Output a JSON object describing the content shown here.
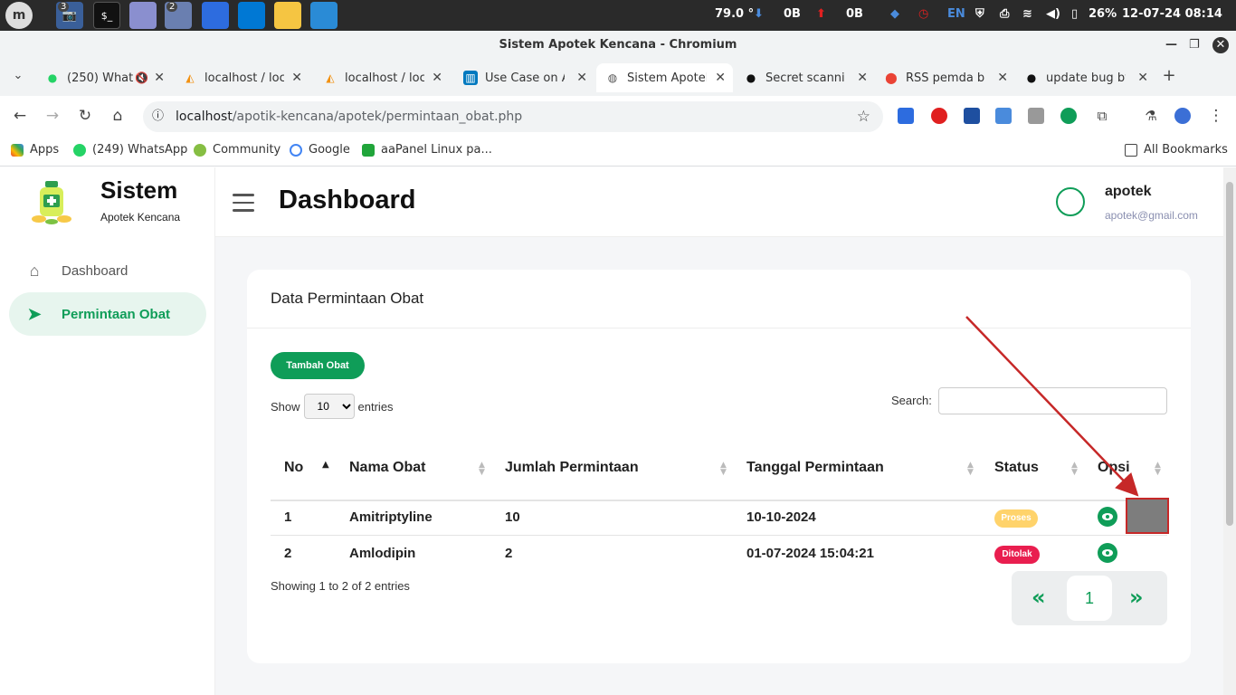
{
  "taskbar": {
    "badges": {
      "camera": "3",
      "browser": "2"
    },
    "temp": "79.0 °",
    "net_down": "0B",
    "net_up": "0B",
    "lang": "EN",
    "battery": "26%",
    "datetime": "12-07-24 08:14"
  },
  "window": {
    "title": "Sistem Apotek Kencana - Chromium"
  },
  "tabs": [
    {
      "title": "(250) What",
      "icon": "whatsapp-icon"
    },
    {
      "title": "localhost / loc",
      "icon": "phpmyadmin-icon"
    },
    {
      "title": "localhost / loc",
      "icon": "phpmyadmin-icon"
    },
    {
      "title": "Use Case on A",
      "icon": "trello-icon"
    },
    {
      "title": "Sistem Apotek",
      "icon": "globe-icon"
    },
    {
      "title": "Secret scannin",
      "icon": "github-icon"
    },
    {
      "title": "RSS pemda bli",
      "icon": "maps-icon"
    },
    {
      "title": "update bug by",
      "icon": "github-icon"
    }
  ],
  "address": {
    "host": "localhost",
    "path": "/apotik-kencana/apotek/permintaan_obat.php"
  },
  "bookmarks": {
    "apps": "Apps",
    "whatsapp": "(249) WhatsApp",
    "community": "Community",
    "google": "Google",
    "aapanel": "aaPanel Linux pa...",
    "all": "All Bookmarks"
  },
  "sidebar": {
    "brand": "Sistem",
    "brand_sub": "Apotek Kencana",
    "items": [
      {
        "label": "Dashboard"
      },
      {
        "label": "Permintaan Obat"
      }
    ]
  },
  "header": {
    "title": "Dashboard",
    "user_name": "apotek",
    "user_email": "apotek@gmail.com"
  },
  "card": {
    "title": "Data Permintaan Obat",
    "add_button": "Tambah Obat",
    "show_label": "Show",
    "show_value": "10",
    "entries_label": "entries",
    "search_label": "Search:",
    "columns": [
      "No",
      "Nama Obat",
      "Jumlah Permintaan",
      "Tanggal Permintaan",
      "Status",
      "Opsi"
    ],
    "rows": [
      {
        "no": "1",
        "nama": "Amitriptyline",
        "jumlah": "10",
        "tanggal": "10-10-2024",
        "status": "Proses"
      },
      {
        "no": "2",
        "nama": "Amlodipin",
        "jumlah": "2",
        "tanggal": "01-07-2024 15:04:21",
        "status": "Ditolak"
      }
    ],
    "info": "Showing 1 to 2 of 2 entries",
    "pager": {
      "prev": "«",
      "current": "1",
      "next": "»"
    }
  },
  "colors": {
    "accent": "#0f9d58",
    "proses": "#ffd36b",
    "ditolak": "#e91e4f",
    "annotation": "#c62828"
  }
}
